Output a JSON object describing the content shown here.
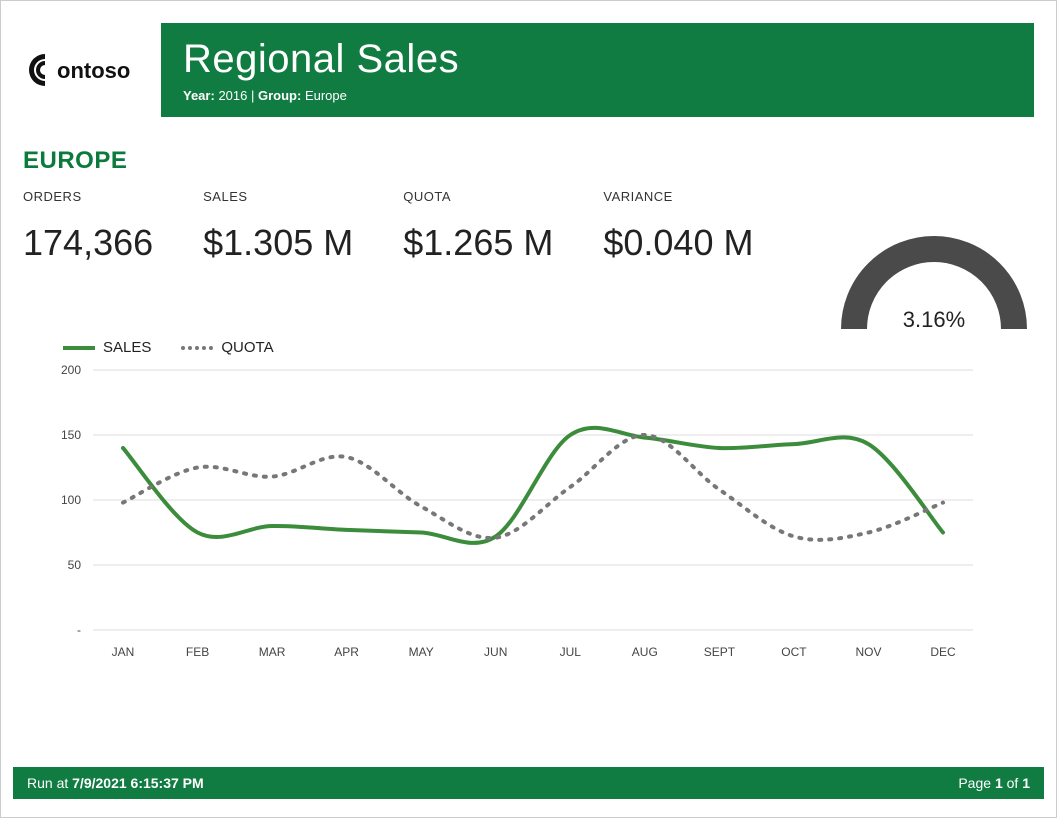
{
  "header": {
    "logo_text": "Contoso",
    "title": "Regional Sales",
    "sub_year_label": "Year:",
    "sub_year_value": "2016",
    "sub_group_label": "Group:",
    "sub_group_value": "Europe"
  },
  "region_title": "EUROPE",
  "kpis": {
    "orders_label": "ORDERS",
    "orders_value": "174,366",
    "sales_label": "SALES",
    "sales_value": "$1.305 M",
    "quota_label": "QUOTA",
    "quota_value": "$1.265 M",
    "variance_label": "VARIANCE",
    "variance_value": "$0.040 M"
  },
  "gauge": {
    "percent_text": "3.16%",
    "percent": 3.16
  },
  "legend": {
    "sales": "SALES",
    "quota": "QUOTA"
  },
  "chart_data": {
    "type": "line",
    "categories": [
      "JAN",
      "FEB",
      "MAR",
      "APR",
      "MAY",
      "JUN",
      "JUL",
      "AUG",
      "SEPT",
      "OCT",
      "NOV",
      "DEC"
    ],
    "series": [
      {
        "name": "SALES",
        "color": "#3b8c3b",
        "style": "solid",
        "values": [
          140,
          75,
          80,
          77,
          75,
          72,
          150,
          148,
          140,
          143,
          143,
          75
        ]
      },
      {
        "name": "QUOTA",
        "color": "#777777",
        "style": "dotted",
        "values": [
          98,
          125,
          118,
          133,
          95,
          71,
          110,
          150,
          108,
          72,
          75,
          98
        ]
      }
    ],
    "ylim": [
      0,
      200
    ],
    "y_ticks": [
      0,
      50,
      100,
      150,
      200
    ],
    "y_tick_labels": [
      "-",
      "50",
      "100",
      "150",
      "200"
    ],
    "xlabel": "",
    "ylabel": "",
    "title": ""
  },
  "footer": {
    "run_label": "Run at ",
    "run_time": "7/9/2021 6:15:37 PM",
    "page_label": "Page ",
    "page_num": "1",
    "page_of": " of ",
    "page_total": "1"
  },
  "colors": {
    "brand_green": "#107c41",
    "sales_line": "#3b8c3b",
    "quota_line": "#777777",
    "gauge": "#4a4a4a"
  }
}
